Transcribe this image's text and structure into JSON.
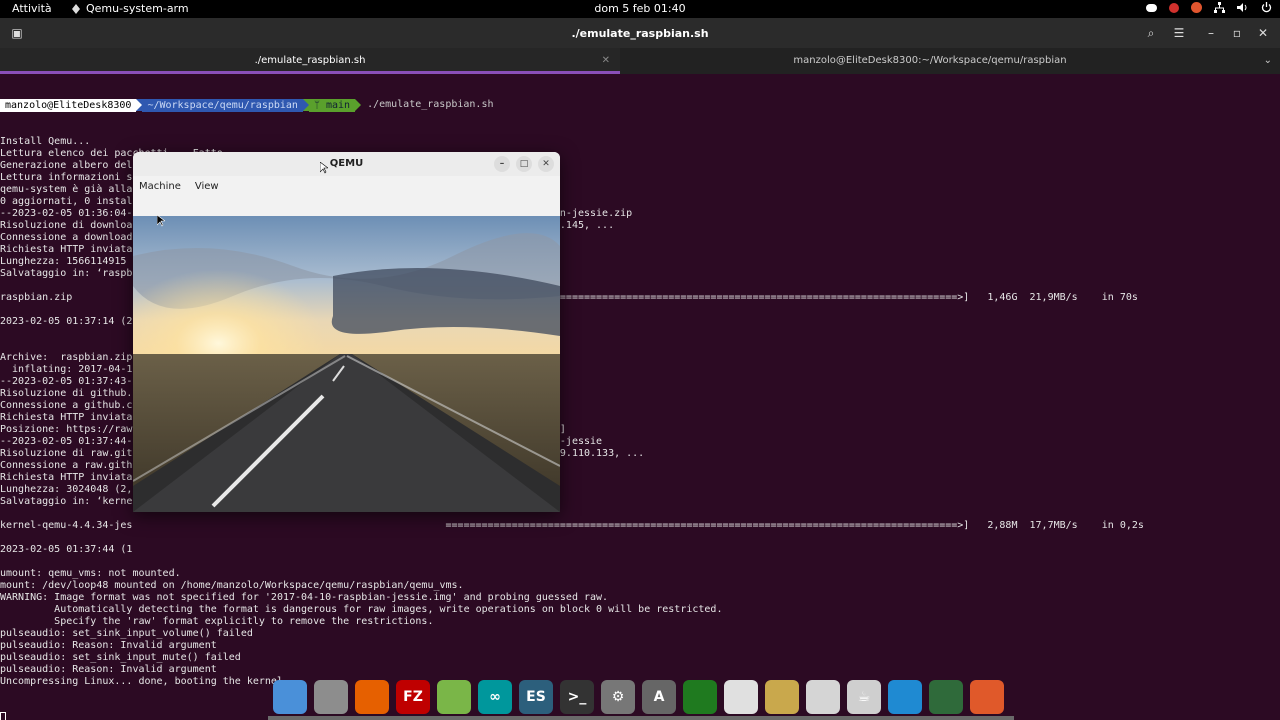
{
  "topbar": {
    "activities": "Attività",
    "app_name": "Qemu-system-arm",
    "clock": "dom 5 feb  01:40"
  },
  "terminal": {
    "window_title": "./emulate_raspbian.sh",
    "tabs": [
      {
        "label": "./emulate_raspbian.sh"
      },
      {
        "label": "manzolo@EliteDesk8300:~/Workspace/qemu/raspbian"
      }
    ],
    "prompt": {
      "user": "manzolo@EliteDesk8300",
      "path": "~/Workspace/qemu/raspbian",
      "branch": "ᛘ main",
      "command": "./emulate_raspbian.sh"
    },
    "lines": [
      "Install Qemu...",
      "Lettura elenco dei pacchetti... Fatto",
      "Generazione albero delle dipendenze... Fatto",
      "Lettura informazioni sullo stato... Fatto",
      "qemu-system è già alla versione più recente (1:6.2+dfsg-2ubuntu6.6).",
      "0 aggiornati, 0 instal",
      "--2023-02-05 01:36:04-                                                    /2017-04-10-raspbian-jessie.zip",
      "Risoluzione di downloa                                                    .240.86, 46.235.231.145, ...",
      "Connessione a download                                                    esso.",
      "Richiesta HTTP inviata",
      "Lunghezza: 1566114915",
      "Salvataggio in: ‘raspb",
      "",
      "raspbian.zip                                                              =====================================================================================>]   1,46G  21,9MB/s    in 70s",
      "",
      "2023-02-05 01:37:14 (2",
      "",
      "",
      "Archive:  raspbian.zip",
      "  inflating: 2017-04-1",
      "--2023-02-05 01:37:43-                                                    u-4.4.34-jessie",
      "Risoluzione di github.",
      "Connessione a github.c",
      "Richiesta HTTP inviata",
      "Posizione: https://raw                                                    .4.34-jessie [segue]",
      "--2023-02-05 01:37:44-                                                    /kernel-qemu-4.4.34-jessie",
      "Risoluzione di raw.git                                                    199.111.133, 185.199.110.133, ...",
      "Connessione a raw.gith                                                    onnesso.",
      "Richiesta HTTP inviata",
      "Lunghezza: 3024048 (2,",
      "Salvataggio in: ‘kerne",
      "",
      "kernel-qemu-4.4.34-jes                                                    =====================================================================================>]   2,88M  17,7MB/s    in 0,2s",
      "",
      "2023-02-05 01:37:44 (1",
      "",
      "umount: qemu_vms: not mounted.",
      "mount: /dev/loop48 mounted on /home/manzolo/Workspace/qemu/raspbian/qemu_vms.",
      "WARNING: Image format was not specified for '2017-04-10-raspbian-jessie.img' and probing guessed raw.",
      "         Automatically detecting the format is dangerous for raw images, write operations on block 0 will be restricted.",
      "         Specify the 'raw' format explicitly to remove the restrictions.",
      "pulseaudio: set_sink_input_volume() failed",
      "pulseaudio: Reason: Invalid argument",
      "pulseaudio: set_sink_input_mute() failed",
      "pulseaudio: Reason: Invalid argument",
      "Uncompressing Linux... done, booting the kernel."
    ]
  },
  "qemu": {
    "title": "QEMU",
    "menu": [
      "Machine",
      "View"
    ]
  },
  "dock": {
    "icons": [
      {
        "name": "files-folder-icon",
        "color": "#4a90d9",
        "glyph": ""
      },
      {
        "name": "file-manager-icon",
        "color": "#8d8d8d",
        "glyph": ""
      },
      {
        "name": "firefox-icon",
        "color": "#e66000",
        "glyph": ""
      },
      {
        "name": "filezilla-icon",
        "color": "#bf0000",
        "glyph": "FZ"
      },
      {
        "name": "3d-cube-icon",
        "color": "#7ab648",
        "glyph": ""
      },
      {
        "name": "arduino-icon",
        "color": "#00979c",
        "glyph": "∞"
      },
      {
        "name": "es-icon",
        "color": "#2c5f7c",
        "glyph": "ES"
      },
      {
        "name": "terminal-icon",
        "color": "#333333",
        "glyph": ">_"
      },
      {
        "name": "settings-gear-icon",
        "color": "#777777",
        "glyph": "⚙"
      },
      {
        "name": "app-store-icon",
        "color": "#666666",
        "glyph": "A"
      },
      {
        "name": "green-sphere-icon",
        "color": "#1f7a1f",
        "glyph": ""
      },
      {
        "name": "clock-icon",
        "color": "#e0e0e0",
        "glyph": ""
      },
      {
        "name": "spreadsheet-icon",
        "color": "#c9a84c",
        "glyph": ""
      },
      {
        "name": "trash-icon",
        "color": "#d5d5d5",
        "glyph": ""
      },
      {
        "name": "java-coffee-icon",
        "color": "#cfcfcf",
        "glyph": "☕"
      },
      {
        "name": "vscode-icon",
        "color": "#1f8ad2",
        "glyph": ""
      },
      {
        "name": "globe-icon",
        "color": "#2f6a3a",
        "glyph": ""
      },
      {
        "name": "bird-icon",
        "color": "#e0592a",
        "glyph": ""
      }
    ]
  }
}
